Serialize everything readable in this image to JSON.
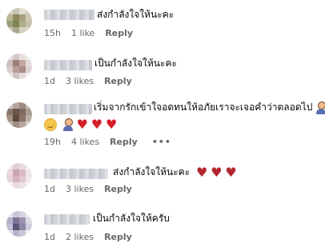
{
  "comments": [
    {
      "text": "ส่งกำลังใจให้นะคะ",
      "time": "15h",
      "likes": "1 like",
      "reply": "Reply"
    },
    {
      "text": "เป็นกำลังใจให้นะคะ",
      "time": "1d",
      "likes": "3 likes",
      "reply": "Reply"
    },
    {
      "text": "เริ่มจากรักเข้าใจอดทนให้อภัยเราจะเจอคำว่าตลอดไป",
      "time": "19h",
      "likes": "4 likes",
      "reply": "Reply",
      "more": "•••"
    },
    {
      "text": "ส่งกำลังใจให้นะคะ",
      "time": "1d",
      "likes": "3 likes",
      "reply": "Reply"
    },
    {
      "text": "เป็นกำลังใจให้ครับ",
      "time": "1d",
      "likes": "2 likes",
      "reply": "Reply"
    }
  ],
  "icons": {
    "heart": "red-heart-icon",
    "broken_heart": "heart-icon",
    "face": "smiling-face-icon",
    "person": "person-icon"
  },
  "colors": {
    "text": "#050505",
    "meta": "#65676b",
    "heart": "#d4202a"
  }
}
